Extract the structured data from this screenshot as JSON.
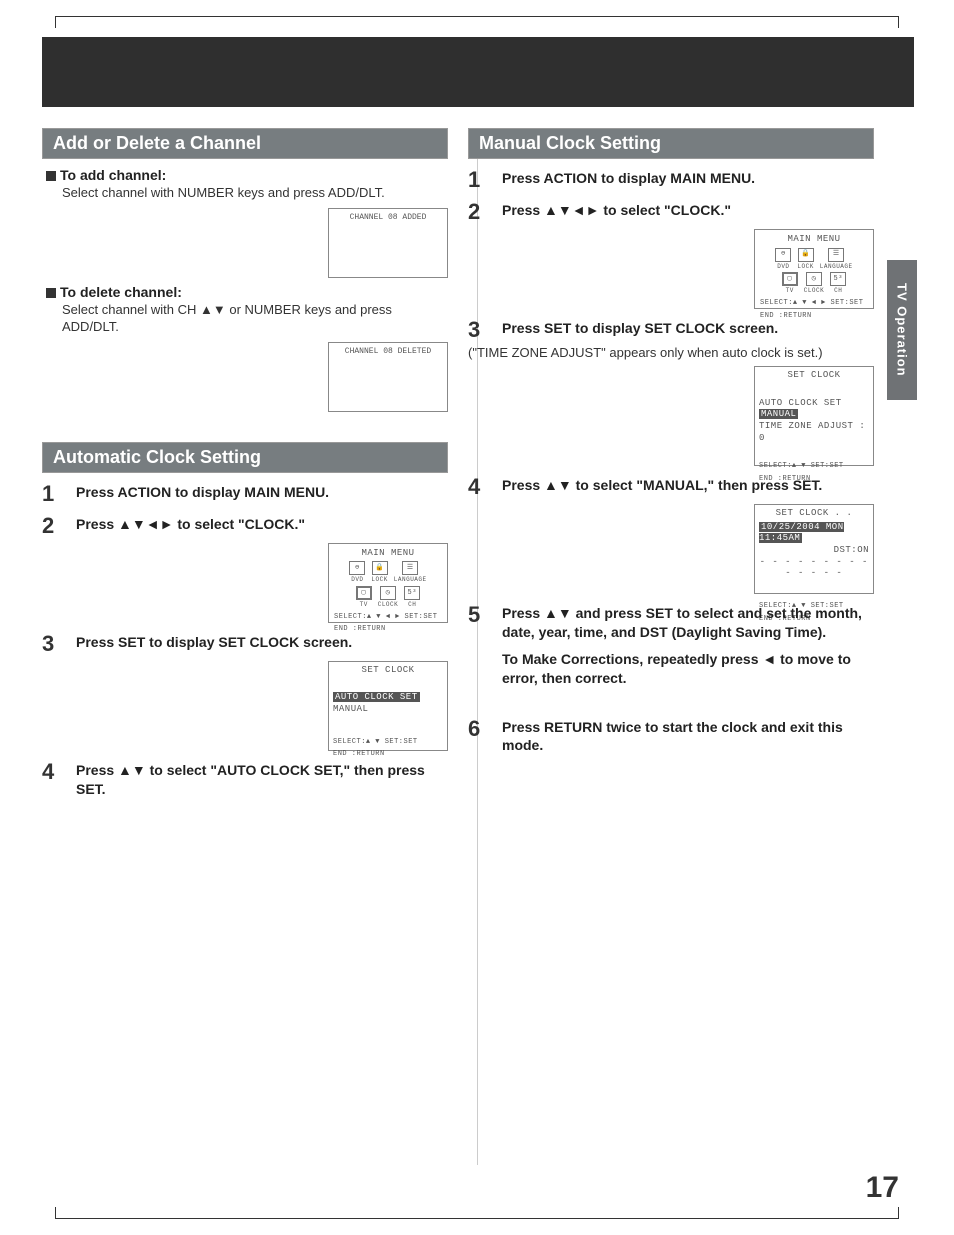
{
  "side_tab": "TV Operation",
  "page_number": "17",
  "left": {
    "section1_title": "Add or Delete a Channel",
    "add_heading": "To add channel:",
    "add_body": "Select channel with NUMBER keys and press ADD/DLT.",
    "add_msg": "CHANNEL 08 ADDED",
    "del_heading": "To delete channel:",
    "del_body": "Select channel with CH ▲▼ or NUMBER keys and press ADD/DLT.",
    "del_msg": "CHANNEL 08 DELETED",
    "section2_title": "Automatic Clock Setting",
    "step1": "Press ACTION to display MAIN MENU.",
    "step2": "Press ▲▼◄► to select \"CLOCK.\"",
    "step3": "Press SET to display SET CLOCK screen.",
    "step4": "Press ▲▼ to select \"AUTO CLOCK SET,\" then press SET.",
    "menu": {
      "title": "MAIN MENU",
      "i": [
        {
          "lbl": "DVD"
        },
        {
          "lbl": "LOCK"
        },
        {
          "lbl": "LANGUAGE"
        },
        {
          "lbl": "TV"
        },
        {
          "lbl": "CLOCK"
        },
        {
          "lbl": "CH"
        }
      ],
      "foot1": "SELECT:▲ ▼ ◄ ►   SET:SET",
      "foot2": "END   :RETURN"
    },
    "setclock": {
      "title": "SET CLOCK",
      "l1": "AUTO CLOCK SET",
      "l2": "MANUAL",
      "foot1": "SELECT:▲ ▼        SET:SET",
      "foot2": "END   :RETURN"
    }
  },
  "right": {
    "section_title": "Manual Clock Setting",
    "step1": "Press ACTION to display MAIN MENU.",
    "step2": "Press ▲▼◄► to select \"CLOCK.\"",
    "step3": "Press SET to display SET CLOCK screen.",
    "step3_note": "(\"TIME ZONE ADJUST\" appears only when auto clock is set.)",
    "step4": "Press ▲▼ to select \"MANUAL,\" then press SET.",
    "step5a": "Press ▲▼ and press SET to select and set the month, date, year, time, and DST (Daylight Saving Time).",
    "step5b": "To Make Corrections, repeatedly press ◄ to move to error, then correct.",
    "step6": "Press RETURN twice to start the clock and exit this mode.",
    "menu": {
      "title": "MAIN MENU",
      "i": [
        {
          "lbl": "DVD"
        },
        {
          "lbl": "LOCK"
        },
        {
          "lbl": "LANGUAGE"
        },
        {
          "lbl": "TV"
        },
        {
          "lbl": "CLOCK"
        },
        {
          "lbl": "CH"
        }
      ],
      "foot1": "SELECT:▲ ▼ ◄ ►   SET:SET",
      "foot2": "END   :RETURN"
    },
    "setclock1": {
      "title": "SET CLOCK",
      "l1": "AUTO CLOCK SET",
      "l2": "MANUAL",
      "l3": "TIME ZONE ADJUST : 0",
      "foot1": "SELECT:▲ ▼        SET:SET",
      "foot2": "END   :RETURN"
    },
    "setclock2": {
      "title": "SET CLOCK   . .",
      "l1": "10/25/2004 MON 11:45AM",
      "l2": "DST:ON",
      "dash": "- - - - - - - - - - - - - -",
      "foot1": "SELECT:▲ ▼        SET:SET",
      "foot2": "END   :RETURN"
    }
  }
}
